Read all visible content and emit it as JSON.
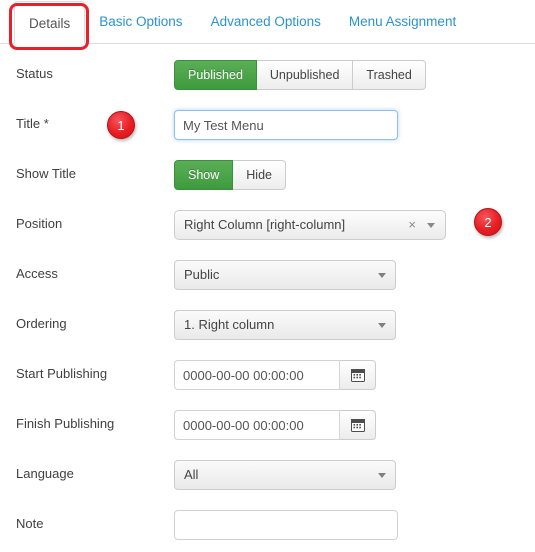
{
  "tabs": [
    {
      "label": "Details",
      "active": true
    },
    {
      "label": "Basic Options",
      "active": false
    },
    {
      "label": "Advanced Options",
      "active": false
    },
    {
      "label": "Menu Assignment",
      "active": false
    }
  ],
  "annotations": {
    "highlight_color": "#e8202a",
    "badges": [
      {
        "number": "1",
        "target": "title-field"
      },
      {
        "number": "2",
        "target": "position-field"
      }
    ]
  },
  "form": {
    "status": {
      "label": "Status",
      "options": [
        "Published",
        "Unpublished",
        "Trashed"
      ],
      "selected": "Published",
      "active_color": "#46a546"
    },
    "title": {
      "label": "Title *",
      "value": "My Test Menu",
      "placeholder": ""
    },
    "show_title": {
      "label": "Show Title",
      "options": [
        "Show",
        "Hide"
      ],
      "selected": "Show"
    },
    "position": {
      "label": "Position",
      "value": "Right Column [right-column]",
      "clear_icon": "×"
    },
    "access": {
      "label": "Access",
      "value": "Public"
    },
    "ordering": {
      "label": "Ordering",
      "value": "1. Right column"
    },
    "start_publishing": {
      "label": "Start Publishing",
      "value": "0000-00-00 00:00:00"
    },
    "finish_publishing": {
      "label": "Finish Publishing",
      "value": "0000-00-00 00:00:00"
    },
    "language": {
      "label": "Language",
      "value": "All"
    },
    "note": {
      "label": "Note",
      "value": "",
      "placeholder": ""
    }
  }
}
